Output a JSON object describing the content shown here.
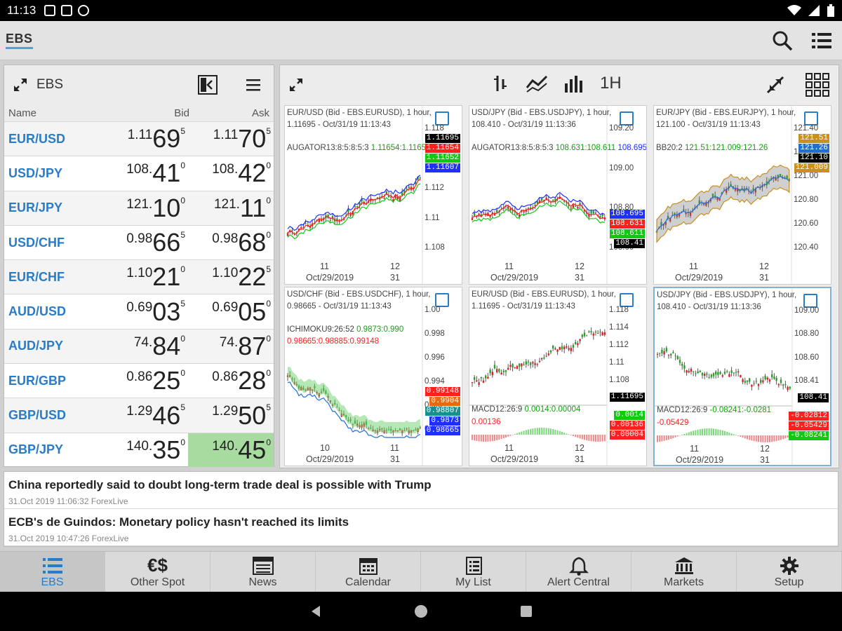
{
  "status_bar": {
    "time": "11:13"
  },
  "app_bar": {
    "brand": "EBS",
    "icons": [
      "search-icon",
      "list-menu-icon"
    ]
  },
  "rates_panel": {
    "title": "EBS",
    "columns": {
      "name": "Name",
      "bid": "Bid",
      "ask": "Ask"
    },
    "rows": [
      {
        "pair": "EUR/USD",
        "bid": {
          "small": "1.11",
          "big": "69",
          "pip": "5"
        },
        "ask": {
          "small": "1.11",
          "big": "70",
          "pip": "5"
        }
      },
      {
        "pair": "USD/JPY",
        "bid": {
          "small": "108.",
          "big": "41",
          "pip": "0"
        },
        "ask": {
          "small": "108.",
          "big": "42",
          "pip": "0"
        }
      },
      {
        "pair": "EUR/JPY",
        "bid": {
          "small": "121.",
          "big": "10",
          "pip": "0"
        },
        "ask": {
          "small": "121.",
          "big": "11",
          "pip": "0"
        }
      },
      {
        "pair": "USD/CHF",
        "bid": {
          "small": "0.98",
          "big": "66",
          "pip": "5"
        },
        "ask": {
          "small": "0.98",
          "big": "68",
          "pip": "0"
        }
      },
      {
        "pair": "EUR/CHF",
        "bid": {
          "small": "1.10",
          "big": "21",
          "pip": "0"
        },
        "ask": {
          "small": "1.10",
          "big": "22",
          "pip": "5"
        }
      },
      {
        "pair": "AUD/USD",
        "bid": {
          "small": "0.69",
          "big": "03",
          "pip": "5"
        },
        "ask": {
          "small": "0.69",
          "big": "05",
          "pip": "0"
        }
      },
      {
        "pair": "AUD/JPY",
        "bid": {
          "small": "74.",
          "big": "84",
          "pip": "0"
        },
        "ask": {
          "small": "74.",
          "big": "87",
          "pip": "0"
        }
      },
      {
        "pair": "EUR/GBP",
        "bid": {
          "small": "0.86",
          "big": "25",
          "pip": "0"
        },
        "ask": {
          "small": "0.86",
          "big": "28",
          "pip": "0"
        }
      },
      {
        "pair": "GBP/USD",
        "bid": {
          "small": "1.29",
          "big": "46",
          "pip": "5"
        },
        "ask": {
          "small": "1.29",
          "big": "50",
          "pip": "5"
        }
      },
      {
        "pair": "GBP/JPY",
        "bid": {
          "small": "140.",
          "big": "35",
          "pip": "0"
        },
        "ask": {
          "small": "140.",
          "big": "45",
          "pip": "0"
        }
      }
    ]
  },
  "charts_panel": {
    "timeframe": "1H",
    "charts": [
      {
        "header": "EUR/USD (Bid - EBS.EURUSD), 1 hour, 1.11695 - Oct/31/19 11:13:43",
        "indicator": "AUGATOR13:8:5:8:5:3",
        "indicator_values": "1.11654:1.11652",
        "y_ticks": [
          "1.118",
          "1.114",
          "1.112",
          "1.11",
          "1.108"
        ],
        "x_ticks": [
          "11",
          "12"
        ],
        "date": "Oct/29/2019",
        "day": "31",
        "price_tags": [
          "1.11695",
          "1.11654",
          "1.11652",
          "1.11607"
        ],
        "tag_colors": [
          "#000000",
          "#ff1f1f",
          "#12c912",
          "#1f2fff"
        ]
      },
      {
        "header": "USD/JPY (Bid - EBS.USDJPY), 1 hour, 108.410 - Oct/31/19 11:13:36",
        "indicator": "AUGATOR13:8:5:8:5:3",
        "indicator_tail": "108.695",
        "indicator_values": "108.631:108.611",
        "y_ticks": [
          "109.20",
          "109.00",
          "108.80",
          "108.60"
        ],
        "x_ticks": [
          "11",
          "12"
        ],
        "date": "Oct/29/2019",
        "day": "31",
        "price_tags": [
          "108.695",
          "108.631",
          "108.611",
          "108.41"
        ],
        "tag_colors": [
          "#1f2fff",
          "#ff1f1f",
          "#12c912",
          "#000000"
        ]
      },
      {
        "header": "EUR/JPY (Bid - EBS.EURJPY), 1 hour, 121.100 - Oct/31/19 11:13:43",
        "indicator": "BB20:2",
        "indicator_values": "121.51:121.009:121.26",
        "y_ticks": [
          "121.40",
          "121.20",
          "121.00",
          "120.80",
          "120.60",
          "120.40"
        ],
        "x_ticks": [
          "11",
          "12"
        ],
        "date": "Oct/29/2019",
        "day": "31",
        "price_tags": [
          "121.51",
          "121.26",
          "121.10",
          "121.009"
        ],
        "tag_colors": [
          "#c8901e",
          "#1f6fd6",
          "#000000",
          "#c8901e"
        ]
      },
      {
        "header": "USD/CHF (Bid - EBS.USDCHF), 1 hour, 0.98665 - Oct/31/19 11:13:43",
        "indicator": "ICHIMOKU9:26:52",
        "indicator_values": "0.9873:0.990",
        "indicator2": "0.98665:0.98885:0.99148",
        "y_ticks": [
          "1.00",
          "0.998",
          "0.996",
          "0.994",
          "0.992",
          "0.988"
        ],
        "x_ticks": [
          "10",
          "11"
        ],
        "date": "Oct/29/2019",
        "day": "31",
        "price_tags": [
          "0.99148",
          "0.9904",
          "0.98807",
          "0.9873",
          "0.98665"
        ],
        "tag_colors": [
          "#ff1f1f",
          "#e86a10",
          "#1a8f8f",
          "#1f2fff",
          "#1f2fff"
        ]
      },
      {
        "header": "EUR/USD (Bid - EBS.EURUSD), 1 hour, 1.11695 - Oct/31/19 11:13:43",
        "indicator": "MACD12:26:9",
        "indicator_values": "0.0014:0.00004",
        "indicator2": "0.00136",
        "y_ticks": [
          "1.118",
          "1.114",
          "1.112",
          "1.11",
          "1.108"
        ],
        "x_ticks": [
          "11",
          "12"
        ],
        "date": "Oct/29/2019",
        "day": "31",
        "price_tags": [
          "1.11695",
          "0.0014",
          "0.00136",
          "0.00004"
        ],
        "tag_colors": [
          "#000000",
          "#12c912",
          "#ff1f1f",
          "#ff1f1f"
        ]
      },
      {
        "header": "USD/JPY (Bid - EBS.USDJPY), 1 hour, 108.410 - Oct/31/19 11:13:36",
        "indicator": "MACD12:26:9",
        "indicator_values": "-0.08241:-0.0281",
        "indicator2": "-0.05429",
        "y_ticks": [
          "109.00",
          "108.80",
          "108.60",
          "108.41"
        ],
        "x_ticks": [
          "11",
          "12"
        ],
        "date": "Oct/29/2019",
        "day": "31",
        "price_tags": [
          "108.41",
          "-0.02812",
          "-0.05429",
          "-0.08241"
        ],
        "tag_colors": [
          "#000000",
          "#ff1f1f",
          "#ff1f1f",
          "#12c912"
        ]
      }
    ]
  },
  "news": [
    {
      "headline": "China reportedly said to doubt long-term trade deal is possible with Trump",
      "meta": "31.Oct 2019 11:06:32  ForexLive"
    },
    {
      "headline": "ECB's de Guindos: Monetary policy hasn't reached its limits",
      "meta": "31.Oct 2019 10:47:26  ForexLive"
    }
  ],
  "bottom_nav": [
    {
      "label": "EBS",
      "icon": "list-icon",
      "active": true
    },
    {
      "label": "Other Spot",
      "icon": "currency-icon"
    },
    {
      "label": "News",
      "icon": "newspaper-icon"
    },
    {
      "label": "Calendar",
      "icon": "calendar-icon"
    },
    {
      "label": "My List",
      "icon": "mylist-icon"
    },
    {
      "label": "Alert Central",
      "icon": "bell-icon"
    },
    {
      "label": "Markets",
      "icon": "bank-icon"
    },
    {
      "label": "Setup",
      "icon": "gear-icon"
    }
  ]
}
